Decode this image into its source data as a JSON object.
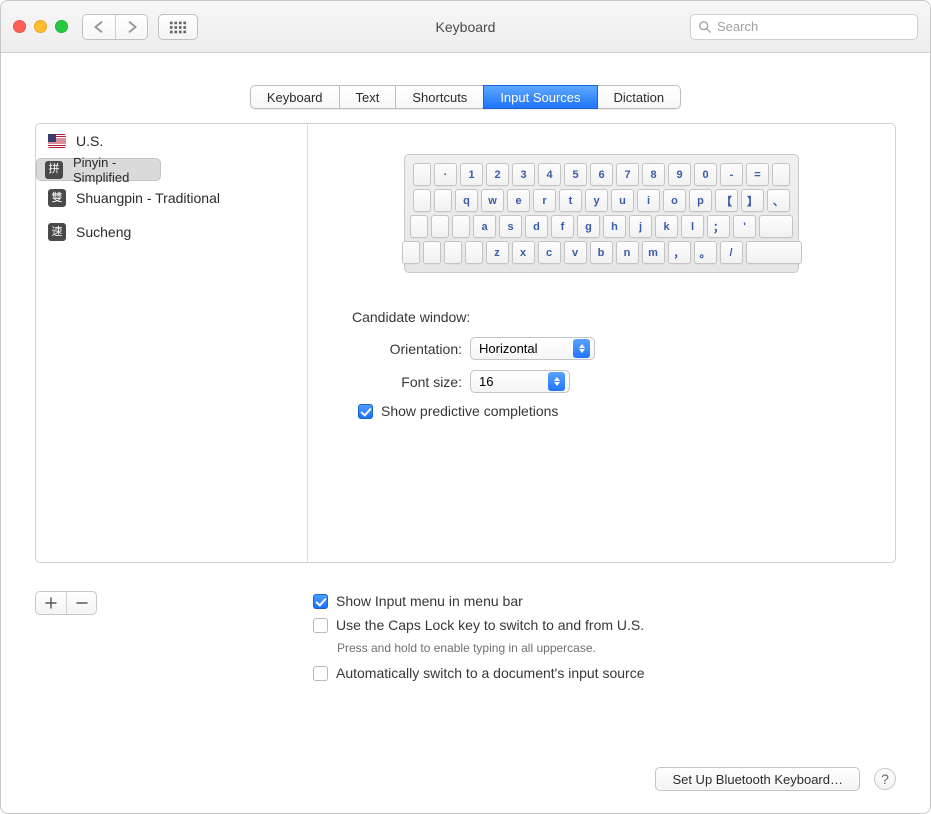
{
  "window": {
    "title": "Keyboard"
  },
  "search": {
    "placeholder": "Search"
  },
  "tabs": [
    "Keyboard",
    "Text",
    "Shortcuts",
    "Input Sources",
    "Dictation"
  ],
  "active_tab": 3,
  "sources": [
    {
      "label": "U.S.",
      "icon": "flag-us"
    },
    {
      "label": "Pinyin - Simplified",
      "icon": "拼"
    },
    {
      "label": "Shuangpin - Traditional",
      "icon": "雙"
    },
    {
      "label": "Sucheng",
      "icon": "速"
    }
  ],
  "selected_source": 1,
  "keyboard_rows": [
    [
      "·",
      "1",
      "2",
      "3",
      "4",
      "5",
      "6",
      "7",
      "8",
      "9",
      "0",
      "-",
      "="
    ],
    [
      "q",
      "w",
      "e",
      "r",
      "t",
      "y",
      "u",
      "i",
      "o",
      "p",
      "【",
      "】",
      "、"
    ],
    [
      "a",
      "s",
      "d",
      "f",
      "g",
      "h",
      "j",
      "k",
      "l",
      "；",
      "'"
    ],
    [
      "z",
      "x",
      "c",
      "v",
      "b",
      "n",
      "m",
      "，",
      "。",
      "/"
    ]
  ],
  "candidate": {
    "heading": "Candidate window:",
    "orientation_label": "Orientation:",
    "orientation_value": "Horizontal",
    "fontsize_label": "Font size:",
    "fontsize_value": "16",
    "predictive_label": "Show predictive completions",
    "predictive_checked": true
  },
  "options": {
    "show_menu": {
      "label": "Show Input menu in menu bar",
      "checked": true
    },
    "caps_lock": {
      "label": "Use the Caps Lock key to switch to and from U.S.",
      "checked": false,
      "hint": "Press and hold to enable typing in all uppercase."
    },
    "auto_switch": {
      "label": "Automatically switch to a document's input source",
      "checked": false
    }
  },
  "footer": {
    "bluetooth": "Set Up Bluetooth Keyboard…",
    "help": "?"
  }
}
